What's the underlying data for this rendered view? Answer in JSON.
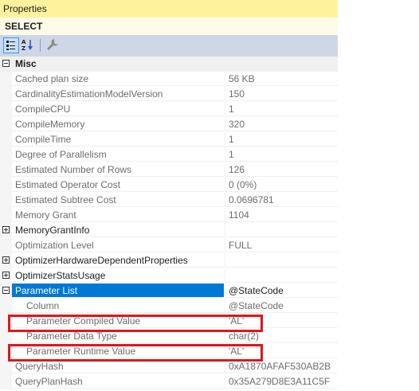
{
  "panel": {
    "title": "Properties",
    "object": "SELECT"
  },
  "toolbar": {
    "buttons": [
      "categorized-icon",
      "alphabetical-icon",
      "property-pages-icon"
    ]
  },
  "category": {
    "label": "Misc"
  },
  "rows": [
    {
      "name": "Cached plan size",
      "value": "56 KB"
    },
    {
      "name": "CardinalityEstimationModelVersion",
      "value": "150"
    },
    {
      "name": "CompileCPU",
      "value": "1"
    },
    {
      "name": "CompileMemory",
      "value": "320"
    },
    {
      "name": "CompileTime",
      "value": "1"
    },
    {
      "name": "Degree of Parallelism",
      "value": "1"
    },
    {
      "name": "Estimated Number of Rows",
      "value": "126"
    },
    {
      "name": "Estimated Operator Cost",
      "value": "0 (0%)"
    },
    {
      "name": "Estimated Subtree Cost",
      "value": "0.0696781"
    },
    {
      "name": "Memory Grant",
      "value": "1104"
    },
    {
      "name": "MemoryGrantInfo",
      "value": ""
    },
    {
      "name": "Optimization Level",
      "value": "FULL"
    },
    {
      "name": "OptimizerHardwareDependentProperties",
      "value": ""
    },
    {
      "name": "OptimizerStatsUsage",
      "value": ""
    },
    {
      "name": "Parameter List",
      "value": "@StateCode"
    },
    {
      "name": "Column",
      "value": "@StateCode"
    },
    {
      "name": "Parameter Compiled Value",
      "value": "'AL'"
    },
    {
      "name": "Parameter Data Type",
      "value": "char(2)"
    },
    {
      "name": "Parameter Runtime Value",
      "value": "'AL'"
    },
    {
      "name": "QueryHash",
      "value": "0xA1870AFAF530AB2B"
    },
    {
      "name": "QueryPlanHash",
      "value": "0x35A279D8E3A11C5F"
    }
  ],
  "colors": {
    "title_bg": "#fff29d",
    "toolbar_bg": "#cfd6e5",
    "selection": "#0078d7",
    "highlight": "#e0151e"
  }
}
